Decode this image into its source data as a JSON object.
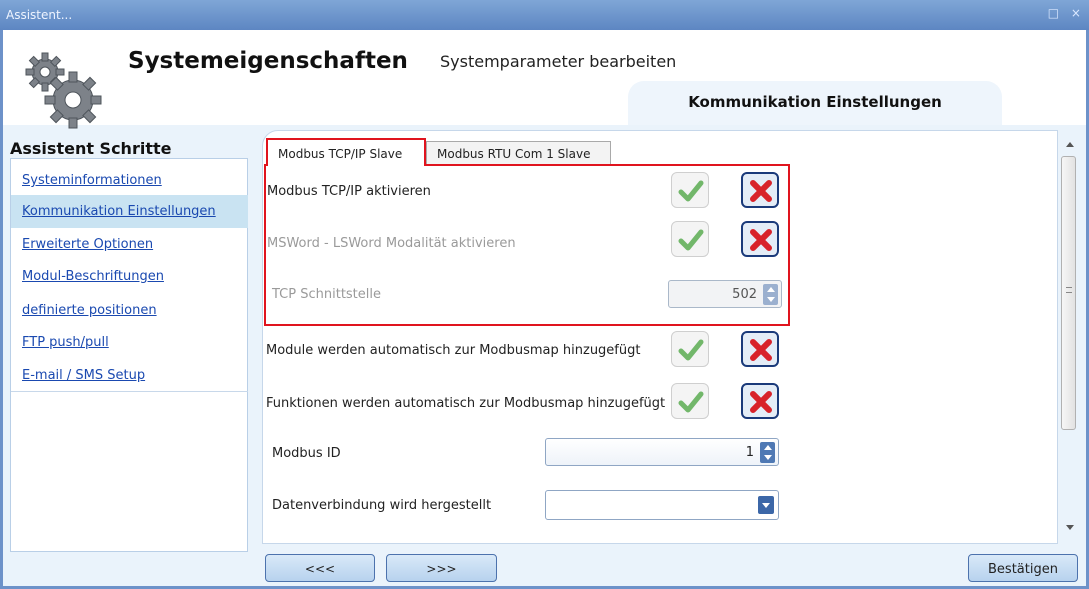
{
  "window": {
    "title": "Assistent...",
    "controls": "□ ×"
  },
  "header": {
    "title": "Systemeigenschaften",
    "subtitle": "Systemparameter bearbeiten",
    "current_step": "Kommunikation Einstellungen"
  },
  "sidebar": {
    "title": "Assistent Schritte",
    "items": [
      {
        "label": "Systeminformationen",
        "active": false
      },
      {
        "label": "Kommunikation Einstellungen",
        "active": true
      },
      {
        "label": "Erweiterte Optionen",
        "active": false
      },
      {
        "label": "Modul-Beschriftungen",
        "active": false
      },
      {
        "label": "definierte positionen",
        "active": false
      },
      {
        "label": "FTP push/pull",
        "active": false
      },
      {
        "label": "E-mail / SMS Setup",
        "active": false
      }
    ]
  },
  "tabs": [
    {
      "label": "Modbus TCP/IP Slave",
      "selected": true
    },
    {
      "label": "Modbus RTU Com 1 Slave",
      "selected": false
    }
  ],
  "settings": {
    "tcp_enable": {
      "label": "Modbus TCP/IP aktivieren",
      "enabled": true
    },
    "msword_enable": {
      "label": "MSWord - LSWord Modalität aktivieren",
      "enabled": false
    },
    "tcp_port": {
      "label": "TCP Schnittstelle",
      "value": "502",
      "enabled": false
    },
    "modules_auto": {
      "label": "Module werden automatisch zur Modbusmap hinzugefügt"
    },
    "functions_auto": {
      "label": "Funktionen  werden automatisch zur Modbusmap hinzugefügt"
    },
    "modbus_id": {
      "label": "Modbus ID",
      "value": "1"
    },
    "data_connection": {
      "label": "Datenverbindung wird hergestellt",
      "value": ""
    }
  },
  "footer": {
    "back_label": "<<<",
    "next_label": ">>>",
    "confirm_label": "Bestätigen"
  },
  "colors": {
    "highlight_box": "#e0141e",
    "link": "#1a49b0",
    "active_item": "#c9e3f2"
  },
  "icons": {
    "header": "gears-icon",
    "check": "green-check-icon",
    "cross": "red-x-icon"
  }
}
